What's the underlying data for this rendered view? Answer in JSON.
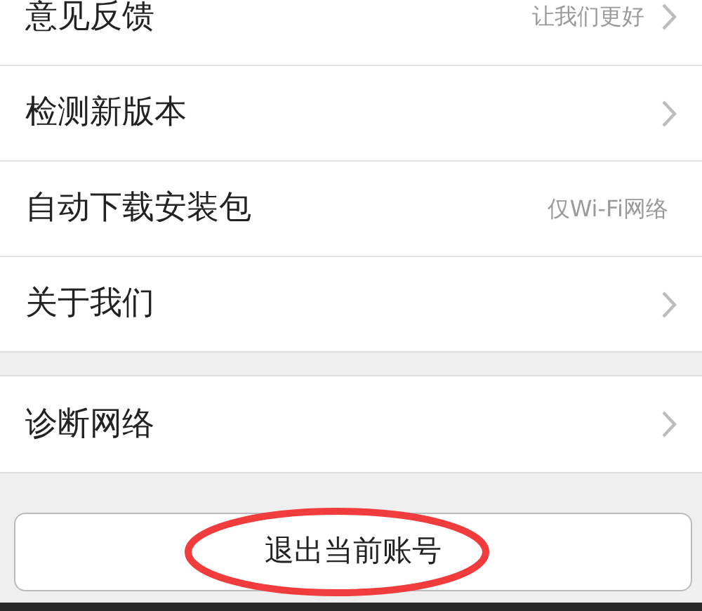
{
  "sections": [
    {
      "items": [
        {
          "kind": "nav",
          "label": "意见反馈",
          "value": "让我们更好"
        },
        {
          "kind": "nav",
          "label": "检测新版本"
        },
        {
          "kind": "option",
          "label": "自动下载安装包",
          "value": "仅Wi-Fi网络"
        },
        {
          "kind": "nav",
          "label": "关于我们"
        }
      ]
    },
    {
      "items": [
        {
          "kind": "nav",
          "label": "诊断网络"
        }
      ]
    }
  ],
  "logout_button": {
    "label": "退出当前账号"
  }
}
